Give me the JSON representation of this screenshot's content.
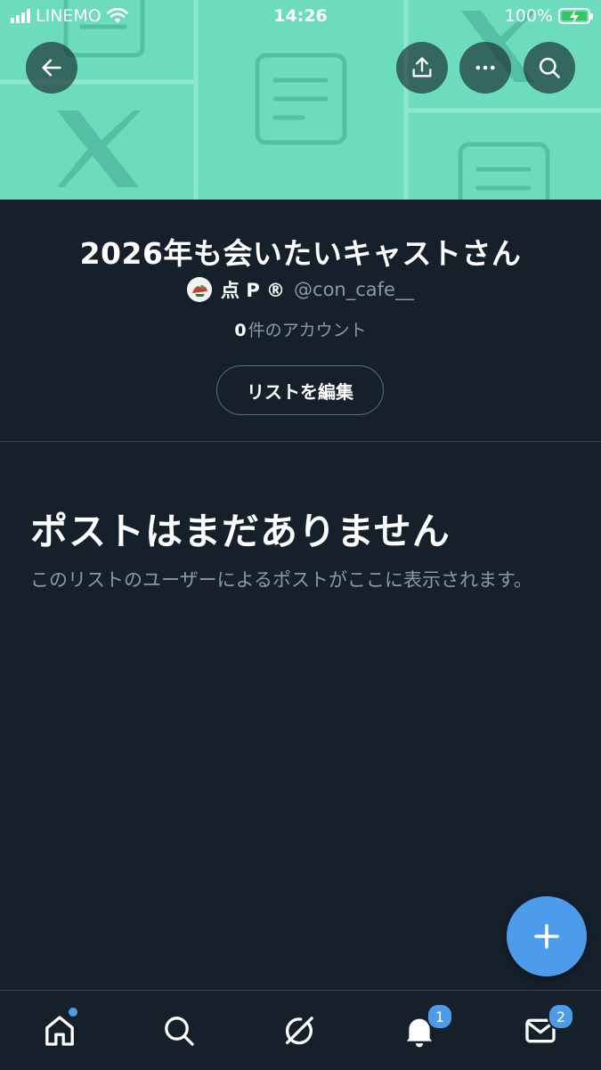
{
  "status_bar": {
    "carrier": "LINEMO",
    "time": "14:26",
    "battery": "100%",
    "battery_color": "#34c759"
  },
  "banner": {
    "background_color": "#6cdcbd",
    "buttons": [
      {
        "icon": "back-arrow-icon"
      },
      {
        "icon": "share-icon"
      },
      {
        "icon": "more-icon"
      },
      {
        "icon": "search-icon"
      }
    ]
  },
  "list": {
    "title": "2026年も会いたいキャストさん",
    "owner_name": "点 P ®",
    "owner_handle": "@con_cafe__",
    "member_count": "0",
    "member_label": "件のアカウント",
    "edit_button": "リストを編集"
  },
  "empty_state": {
    "title": "ポストはまだありません",
    "description": "このリストのユーザーによるポストがここに表示されます。"
  },
  "fab": {
    "icon": "plus-icon",
    "color": "#4c9ceb"
  },
  "bottom_nav": {
    "items": [
      {
        "icon": "home-icon",
        "has_dot": true
      },
      {
        "icon": "search-icon"
      },
      {
        "icon": "grok-icon"
      },
      {
        "icon": "bell-icon",
        "badge": "1"
      },
      {
        "icon": "mail-icon",
        "badge": "2"
      }
    ]
  },
  "colors": {
    "background": "#15202b",
    "accent": "#4c9ceb",
    "secondary_text": "#8b98a5"
  }
}
